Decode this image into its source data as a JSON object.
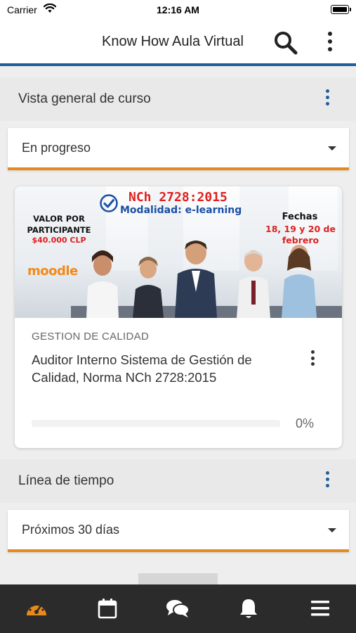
{
  "status_bar": {
    "carrier": "Carrier",
    "time": "12:16 AM"
  },
  "header": {
    "title": "Know How Aula Virtual",
    "icons": [
      "search-icon",
      "more-vertical-icon"
    ]
  },
  "course_overview": {
    "title": "Vista general de curso",
    "filter": {
      "selected": "En progreso"
    },
    "courses": [
      {
        "category": "GESTION DE CALIDAD",
        "name": "Auditor Interno Sistema de Gestión de Calidad, Norma NCh 2728:2015",
        "progress_percent": 0,
        "progress_label": "0%",
        "image": {
          "title": "NCh 2728:2015",
          "subtitle": "Modalidad: e-learning",
          "price_heading": "VALOR POR PARTICIPANTE",
          "price": "$40.000 CLP",
          "dates_heading": "Fechas",
          "dates": "18, 19 y 20 de febrero",
          "logo": "moodle"
        }
      }
    ]
  },
  "timeline": {
    "title": "Línea de tiempo",
    "filter": {
      "selected": "Próximos 30 días"
    }
  },
  "tab_bar": {
    "tabs": [
      "dashboard-icon",
      "calendar-icon",
      "messages-icon",
      "notifications-icon",
      "menu-icon"
    ],
    "active": "dashboard-icon"
  },
  "colors": {
    "accent": "#e8891b",
    "brand_blue": "#1f5f9c",
    "tab_bar": "#2b2b2b",
    "tab_inactive": "#ffffff"
  }
}
